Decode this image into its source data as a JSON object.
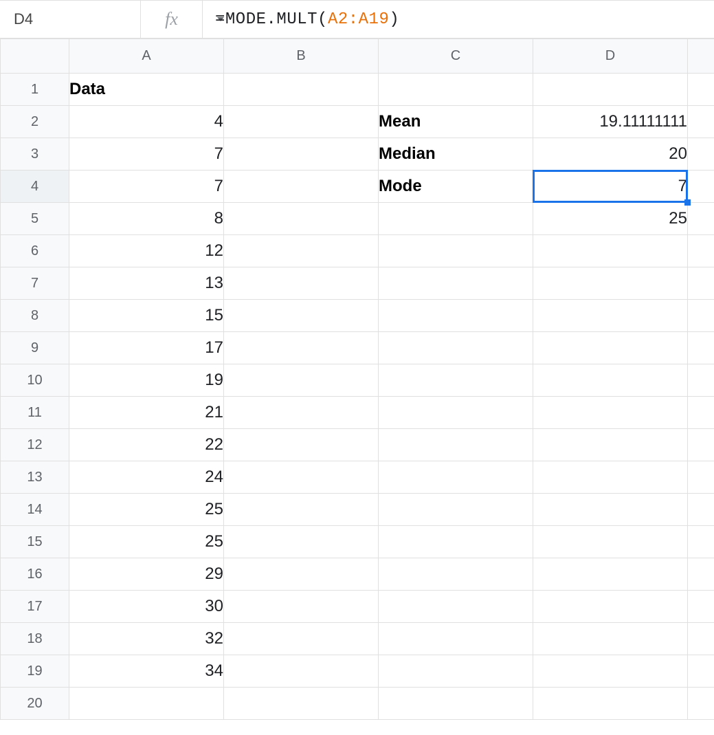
{
  "namebox": {
    "value": "D4"
  },
  "formula": {
    "eq": "=",
    "fn": "MODE.MULT",
    "open": "(",
    "ref": "A2:A19",
    "close": ")"
  },
  "columns": [
    "A",
    "B",
    "C",
    "D"
  ],
  "rows_count": 20,
  "selected": {
    "row": 4,
    "col": "D"
  },
  "cells": {
    "A1": {
      "v": "Data",
      "style": "bold txt"
    },
    "A2": {
      "v": "4",
      "style": "num"
    },
    "A3": {
      "v": "7",
      "style": "num"
    },
    "A4": {
      "v": "7",
      "style": "num"
    },
    "A5": {
      "v": "8",
      "style": "num"
    },
    "A6": {
      "v": "12",
      "style": "num"
    },
    "A7": {
      "v": "13",
      "style": "num"
    },
    "A8": {
      "v": "15",
      "style": "num"
    },
    "A9": {
      "v": "17",
      "style": "num"
    },
    "A10": {
      "v": "19",
      "style": "num"
    },
    "A11": {
      "v": "21",
      "style": "num"
    },
    "A12": {
      "v": "22",
      "style": "num"
    },
    "A13": {
      "v": "24",
      "style": "num"
    },
    "A14": {
      "v": "25",
      "style": "num"
    },
    "A15": {
      "v": "25",
      "style": "num"
    },
    "A16": {
      "v": "29",
      "style": "num"
    },
    "A17": {
      "v": "30",
      "style": "num"
    },
    "A18": {
      "v": "32",
      "style": "num"
    },
    "A19": {
      "v": "34",
      "style": "num"
    },
    "C2": {
      "v": "Mean",
      "style": "bold txt"
    },
    "C3": {
      "v": "Median",
      "style": "bold txt"
    },
    "C4": {
      "v": "Mode",
      "style": "bold txt"
    },
    "D2": {
      "v": "19.11111111",
      "style": "num"
    },
    "D3": {
      "v": "20",
      "style": "num"
    },
    "D4": {
      "v": "7",
      "style": "num"
    },
    "D5": {
      "v": "25",
      "style": "num"
    }
  }
}
